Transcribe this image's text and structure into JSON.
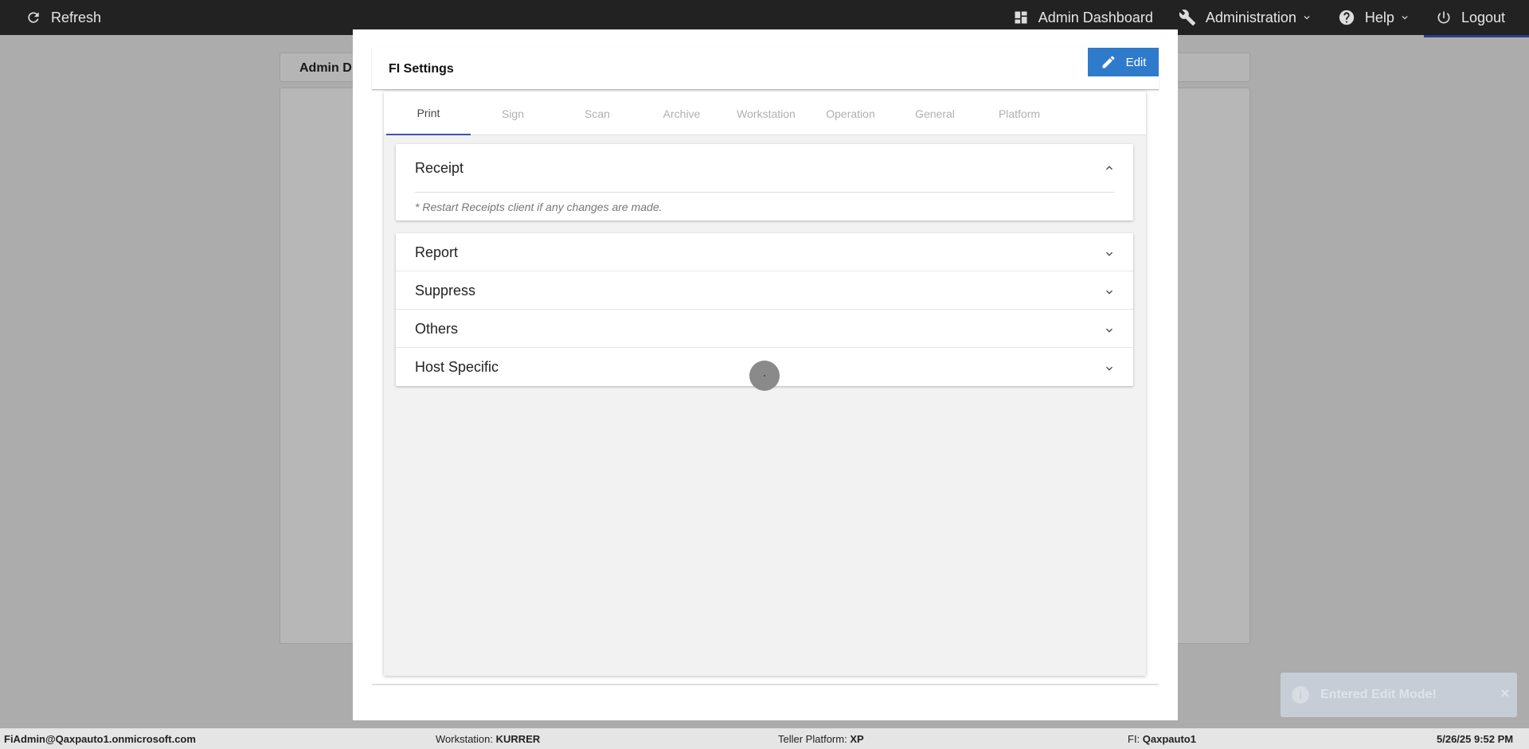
{
  "topbar": {
    "refresh_label": "Refresh",
    "admin_dashboard_label": "Admin Dashboard",
    "administration_label": "Administration",
    "help_label": "Help",
    "logout_label": "Logout"
  },
  "background": {
    "header_title": "Admin D"
  },
  "modal": {
    "title": "FI Settings",
    "edit_label": "Edit",
    "tabs": [
      {
        "label": "Print",
        "active": true
      },
      {
        "label": "Sign"
      },
      {
        "label": "Scan"
      },
      {
        "label": "Archive"
      },
      {
        "label": "Workstation"
      },
      {
        "label": "Operation"
      },
      {
        "label": "General"
      },
      {
        "label": "Platform"
      }
    ],
    "receipt": {
      "title": "Receipt",
      "note": "* Restart Receipts client if any changes are made."
    },
    "sections": [
      "Report",
      "Suppress",
      "Others",
      "Host Specific"
    ]
  },
  "toast": {
    "message": "Entered Edit Mode!",
    "close": "×"
  },
  "statusbar": {
    "user": "FiAdmin@Qaxpauto1.onmicrosoft.com",
    "workstation_label": "Workstation:",
    "workstation_value": "KURRER",
    "teller_label": "Teller Platform:",
    "teller_value": "XP",
    "fi_label": "FI:",
    "fi_value": "Qaxpauto1",
    "datetime": "5/26/25 9:52 PM"
  },
  "colors": {
    "topbar": "#222222",
    "accent": "#3f51b5",
    "edit_button": "#2f7bcb"
  }
}
